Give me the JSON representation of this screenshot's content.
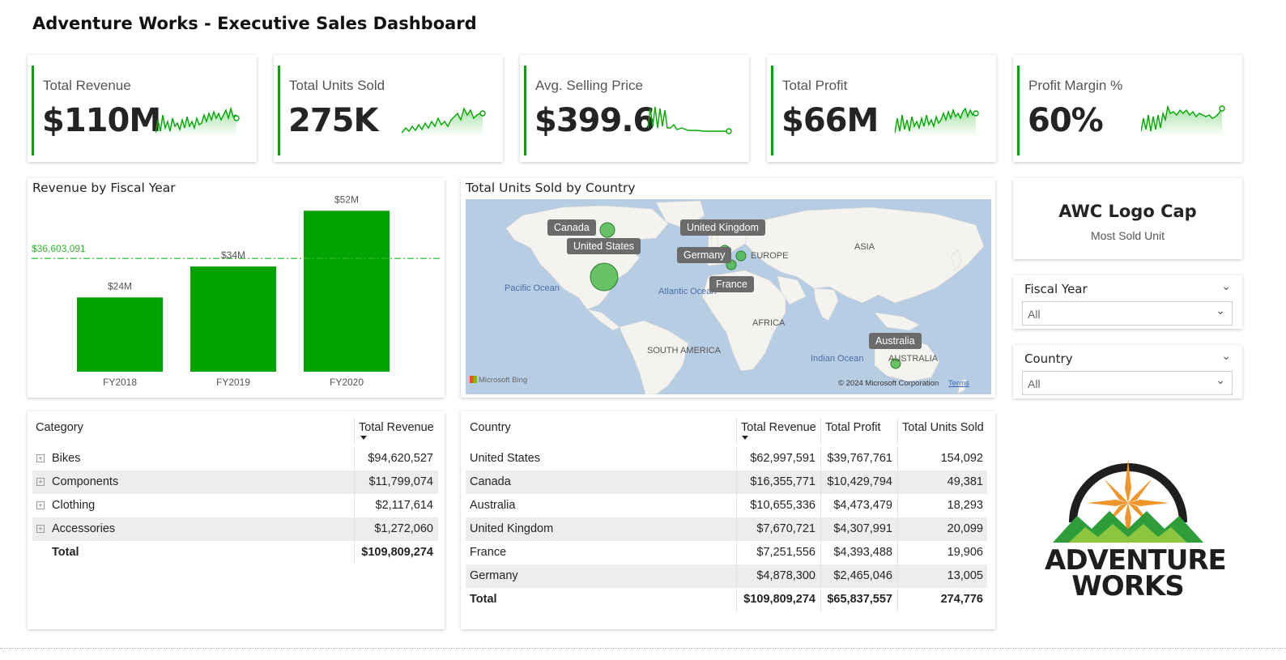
{
  "dashboard": {
    "title": "Adventure Works - Executive Sales Dashboard"
  },
  "kpis": [
    {
      "label": "Total Revenue",
      "value": "$110M"
    },
    {
      "label": "Total Units Sold",
      "value": "275K"
    },
    {
      "label": "Avg. Selling Price",
      "value": "$399.6"
    },
    {
      "label": "Total Profit",
      "value": "$66M"
    },
    {
      "label": "Profit Margin %",
      "value": "60%"
    }
  ],
  "revenue_chart": {
    "title": "Revenue by Fiscal Year",
    "average_label": "$36,603,091",
    "colors": {
      "bar": "#00a300",
      "average_line": "#2eb82e"
    }
  },
  "chart_data": {
    "type": "bar",
    "title": "Revenue by Fiscal Year",
    "categories": [
      "FY2018",
      "FY2019",
      "FY2020"
    ],
    "values": [
      24,
      34,
      52
    ],
    "data_labels": [
      "$24M",
      "$34M",
      "$52M"
    ],
    "unit": "$M",
    "average_line": {
      "label": "$36,603,091",
      "value": 36.603091
    },
    "ylim": [
      0,
      56
    ],
    "grid": false
  },
  "map": {
    "title": "Total Units Sold by Country",
    "tags": [
      "Canada",
      "United States",
      "United Kingdom",
      "Germany",
      "France",
      "Australia"
    ],
    "region_labels": [
      "Pacific Ocean",
      "Atlantic Ocean",
      "EUROPE",
      "ASIA",
      "AFRICA",
      "SOUTH AMERICA",
      "Indian Ocean",
      "AUSTRALIA"
    ],
    "bing": "Microsoft Bing",
    "copyright": "© 2024 Microsoft Corporation",
    "terms": "Terms"
  },
  "top_product": {
    "name": "AWC Logo Cap",
    "caption": "Most Sold Unit"
  },
  "slicers": [
    {
      "label": "Fiscal Year",
      "value": "All"
    },
    {
      "label": "Country",
      "value": "All"
    }
  ],
  "category_table": {
    "headers": [
      "Category",
      "Total Revenue"
    ],
    "rows": [
      {
        "name": "Bikes",
        "revenue": "$94,620,527"
      },
      {
        "name": "Components",
        "revenue": "$11,799,074"
      },
      {
        "name": "Clothing",
        "revenue": "$2,117,614"
      },
      {
        "name": "Accessories",
        "revenue": "$1,272,060"
      }
    ],
    "total": {
      "name": "Total",
      "revenue": "$109,809,274"
    }
  },
  "country_table": {
    "headers": [
      "Country",
      "Total Revenue",
      "Total Profit",
      "Total Units Sold"
    ],
    "rows": [
      {
        "country": "United States",
        "revenue": "$62,997,591",
        "profit": "$39,767,761",
        "units": "154,092"
      },
      {
        "country": "Canada",
        "revenue": "$16,355,771",
        "profit": "$10,429,794",
        "units": "49,381"
      },
      {
        "country": "Australia",
        "revenue": "$10,655,336",
        "profit": "$4,473,479",
        "units": "18,293"
      },
      {
        "country": "United Kingdom",
        "revenue": "$7,670,721",
        "profit": "$4,307,991",
        "units": "20,099"
      },
      {
        "country": "France",
        "revenue": "$7,251,556",
        "profit": "$4,393,488",
        "units": "19,906"
      },
      {
        "country": "Germany",
        "revenue": "$4,878,300",
        "profit": "$2,465,046",
        "units": "13,005"
      }
    ],
    "total": {
      "country": "Total",
      "revenue": "$109,809,274",
      "profit": "$65,837,557",
      "units": "274,776"
    }
  },
  "logo": {
    "line1": "ADVENTURE",
    "line2": "WORKS"
  },
  "colors": {
    "accent": "#00a800",
    "logo_dark": "#1e1e1e",
    "logo_star": "#f0952a",
    "logo_green_dark": "#2e9d3a",
    "logo_green_light": "#8cc63f"
  }
}
